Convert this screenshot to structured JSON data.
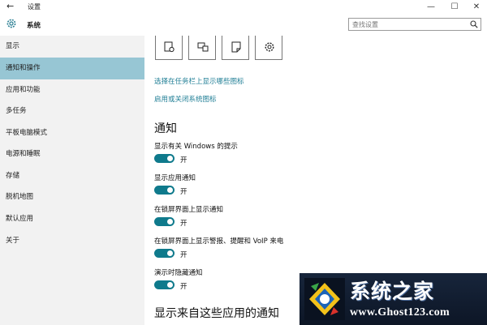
{
  "window": {
    "title": "设置",
    "back_glyph": "←",
    "minimize_glyph": "—",
    "maximize_glyph": "☐",
    "close_glyph": "✕"
  },
  "header": {
    "app_name": "系统",
    "app_icon": "gear-icon",
    "search_placeholder": "查找设置",
    "search_icon": "search-icon"
  },
  "sidebar": {
    "items": [
      {
        "label": "显示",
        "active": false
      },
      {
        "label": "通知和操作",
        "active": true
      },
      {
        "label": "应用和功能",
        "active": false
      },
      {
        "label": "多任务",
        "active": false
      },
      {
        "label": "平板电脑模式",
        "active": false
      },
      {
        "label": "电源和睡眠",
        "active": false
      },
      {
        "label": "存储",
        "active": false
      },
      {
        "label": "脱机地图",
        "active": false
      },
      {
        "label": "默认应用",
        "active": false
      },
      {
        "label": "关于",
        "active": false
      }
    ]
  },
  "quick_actions": {
    "tiles": [
      {
        "icon": "tablet-mode-icon"
      },
      {
        "icon": "project-icon"
      },
      {
        "icon": "note-icon"
      },
      {
        "icon": "settings-icon"
      }
    ]
  },
  "links": {
    "taskbar_icons": "选择在任务栏上显示哪些图标",
    "system_icons": "启用或关闭系统图标"
  },
  "notifications": {
    "heading": "通知",
    "settings": [
      {
        "label": "显示有关 Windows 的提示",
        "state": "开"
      },
      {
        "label": "显示应用通知",
        "state": "开"
      },
      {
        "label": "在锁屏界面上显示通知",
        "state": "开"
      },
      {
        "label": "在锁屏界面上显示警报、提醒和 VoIP 来电",
        "state": "开"
      },
      {
        "label": "演示时隐藏通知",
        "state": "开"
      }
    ],
    "apps_heading": "显示来自这些应用的通知"
  },
  "watermark": {
    "title": "系统之家",
    "url": "www.Ghost123.com"
  },
  "colors": {
    "accent": "#0f7a8c",
    "link": "#1f7e95",
    "sidebar_bg": "#f2f2f2",
    "sidebar_active": "#97c6d4"
  }
}
